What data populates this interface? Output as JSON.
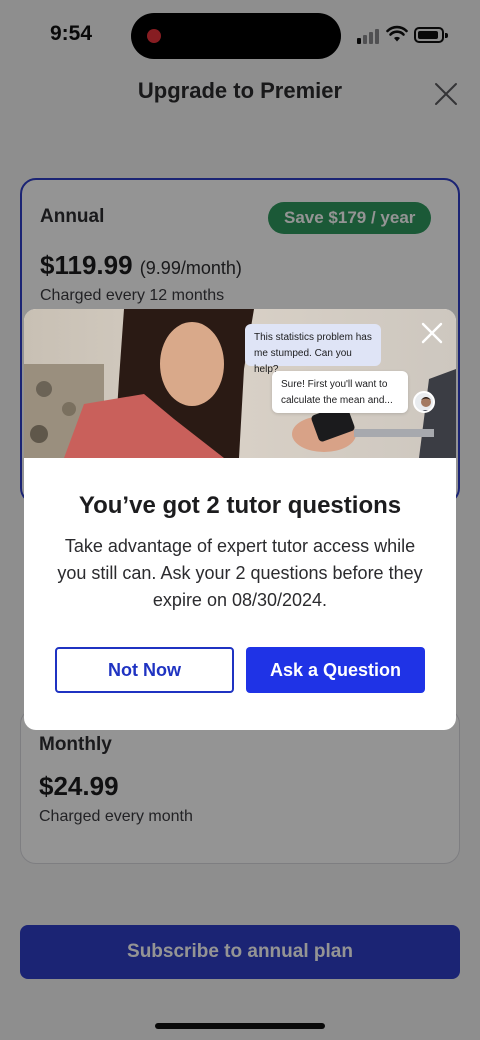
{
  "status_bar": {
    "time": "9:54"
  },
  "header": {
    "title": "Upgrade to Premier"
  },
  "plans": {
    "annual": {
      "name": "Annual",
      "badge": "Save $179 / year",
      "price": "$119.99",
      "price_per_month": "(9.99/month)",
      "charge_text": "Charged every 12 months"
    },
    "monthly": {
      "name": "Monthly",
      "price": "$24.99",
      "charge_text": "Charged every month"
    }
  },
  "subscribe": {
    "label": "Subscribe to annual plan"
  },
  "modal": {
    "chat": {
      "student_message": "This statistics problem has me stumped. Can you help?",
      "tutor_message": "Sure! First you'll want to calculate the mean and..."
    },
    "title": "You’ve got 2 tutor questions",
    "body": "Take advantage of expert tutor access while you still can. Ask your 2 questions before they expire on 08/30/2024.",
    "secondary_button": "Not Now",
    "primary_button": "Ask a Question"
  },
  "colors": {
    "accent": "#1f33e6",
    "save_badge": "#2f9a5f",
    "overlay": "rgba(0,0,0,0.42)"
  },
  "icons": [
    "recording-dot-icon",
    "signal-icon",
    "wifi-icon",
    "battery-icon",
    "close-icon",
    "tutor-avatar"
  ]
}
